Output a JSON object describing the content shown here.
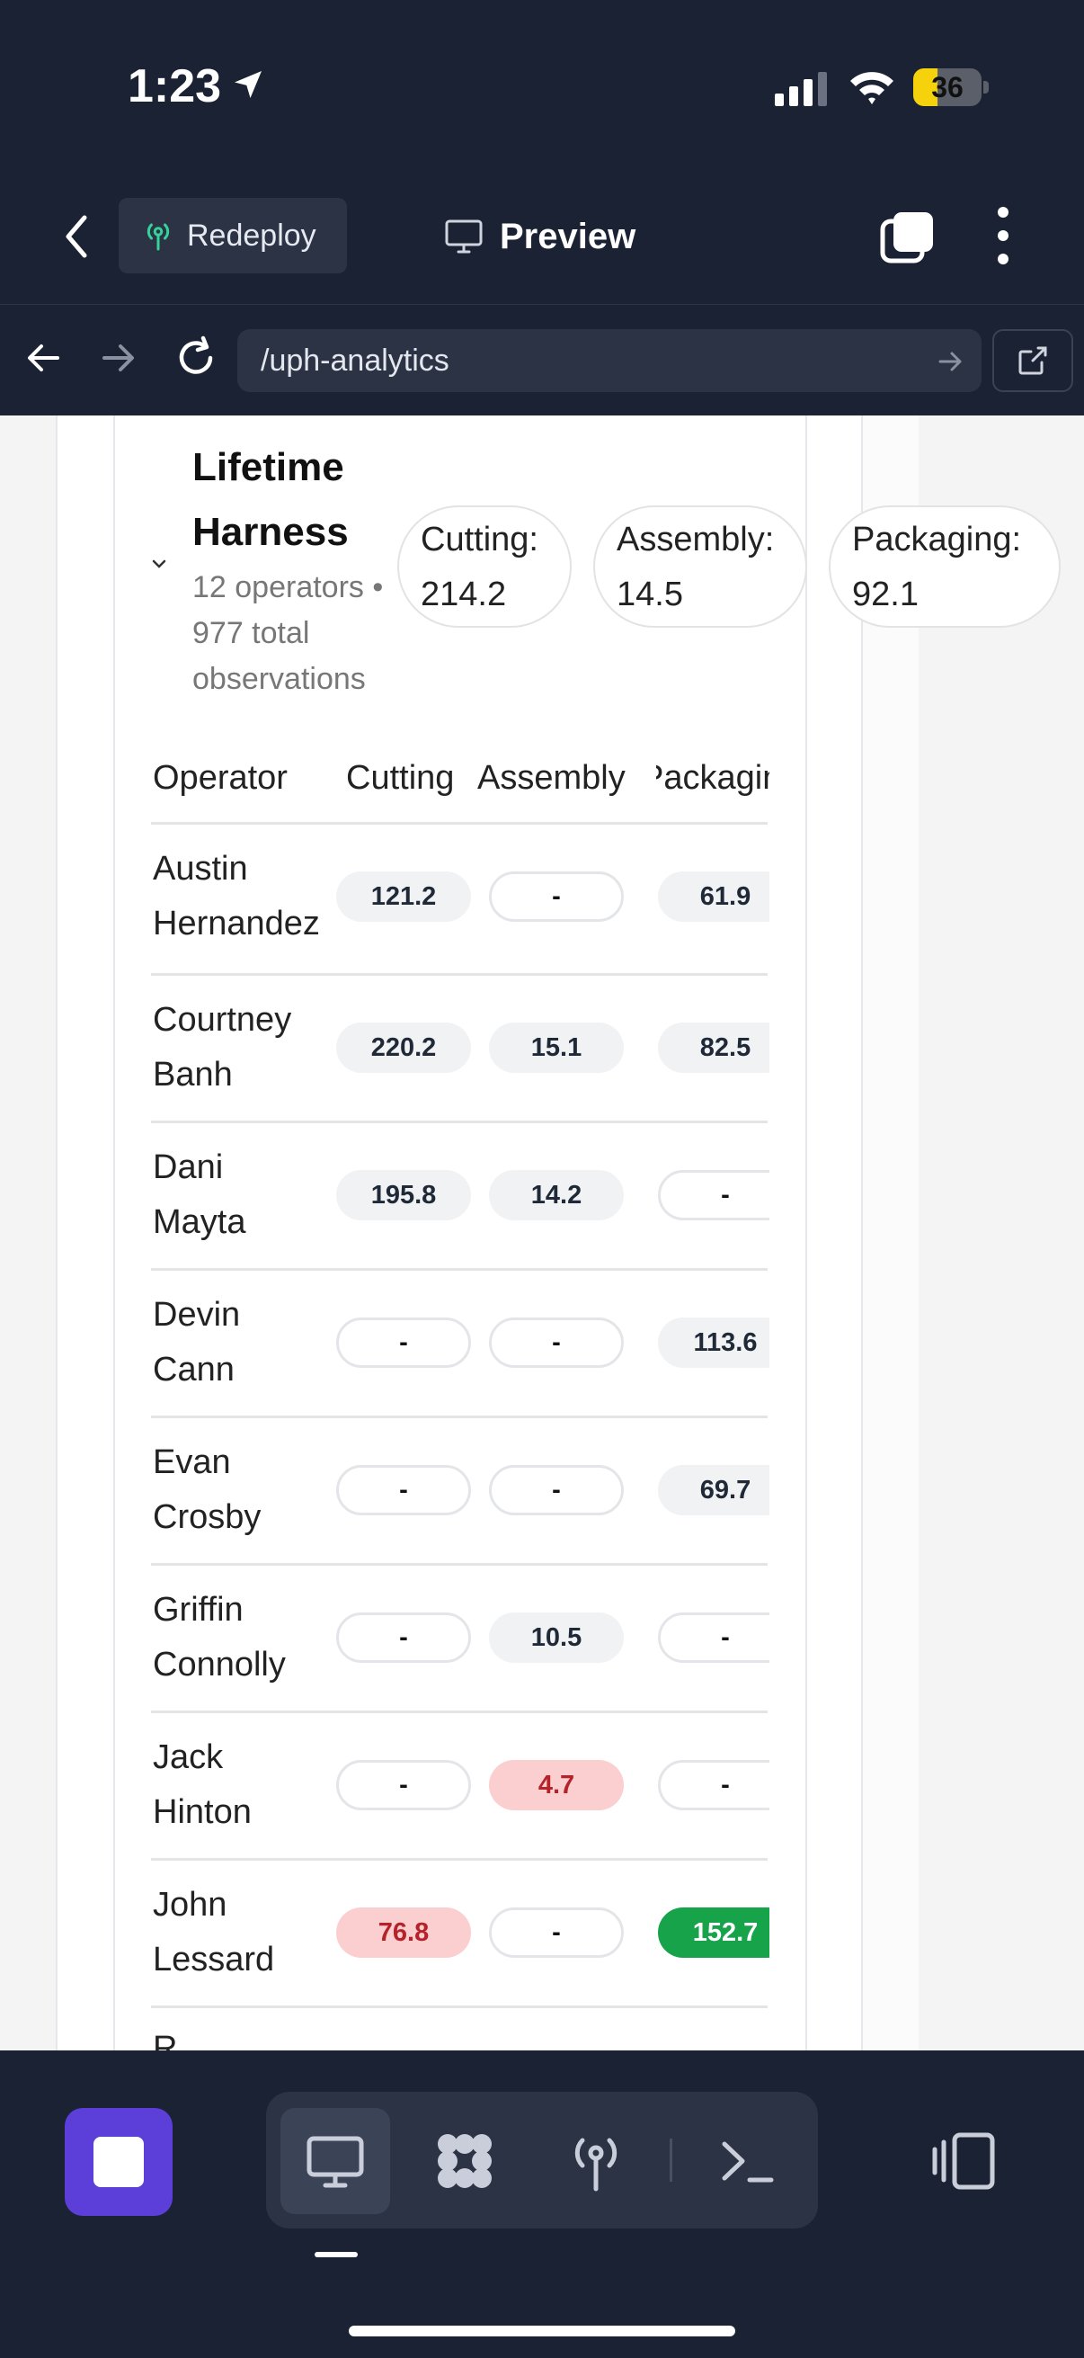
{
  "status_bar": {
    "time": "1:23",
    "battery": "36",
    "battery_level": 0.36
  },
  "app_bar": {
    "redeploy_label": "Redeploy",
    "preview_label": "Preview"
  },
  "url_bar": {
    "url": "/uph-analytics"
  },
  "card": {
    "title": "Lifetime Harness",
    "subtitle": "12 operators • 977 total observations",
    "stats": [
      {
        "label": "Cutting:",
        "value": "214.2"
      },
      {
        "label": "Assembly:",
        "value": "14.5"
      },
      {
        "label": "Packaging:",
        "value": "92.1"
      }
    ]
  },
  "table": {
    "headers": [
      "Operator",
      "Cutting",
      "Assembly",
      "Packaging"
    ],
    "rows": [
      {
        "first": "Austin",
        "last": "Hernandez",
        "cutting": "121.2",
        "assembly": "-",
        "packaging": "61.9"
      },
      {
        "first": "Courtney",
        "last": "Banh",
        "cutting": "220.2",
        "assembly": "15.1",
        "packaging": "82.5"
      },
      {
        "first": "Dani",
        "last": "Mayta",
        "cutting": "195.8",
        "assembly": "14.2",
        "packaging": "-"
      },
      {
        "first": "Devin",
        "last": "Cann",
        "cutting": "-",
        "assembly": "-",
        "packaging": "113.6"
      },
      {
        "first": "Evan",
        "last": "Crosby",
        "cutting": "-",
        "assembly": "-",
        "packaging": "69.7"
      },
      {
        "first": "Griffin",
        "last": "Connolly",
        "cutting": "-",
        "assembly": "10.5",
        "packaging": "-"
      },
      {
        "first": "Jack",
        "last": "Hinton",
        "cutting": "-",
        "assembly": "4.7",
        "packaging": "-"
      },
      {
        "first": "John",
        "last": "Lessard",
        "cutting": "76.8",
        "assembly": "-",
        "packaging": "152.7"
      }
    ]
  },
  "colors": {
    "background": "#1b2233",
    "accent": "#5b3fd8",
    "low": "#fbcfd0",
    "high": "#16a34a"
  }
}
